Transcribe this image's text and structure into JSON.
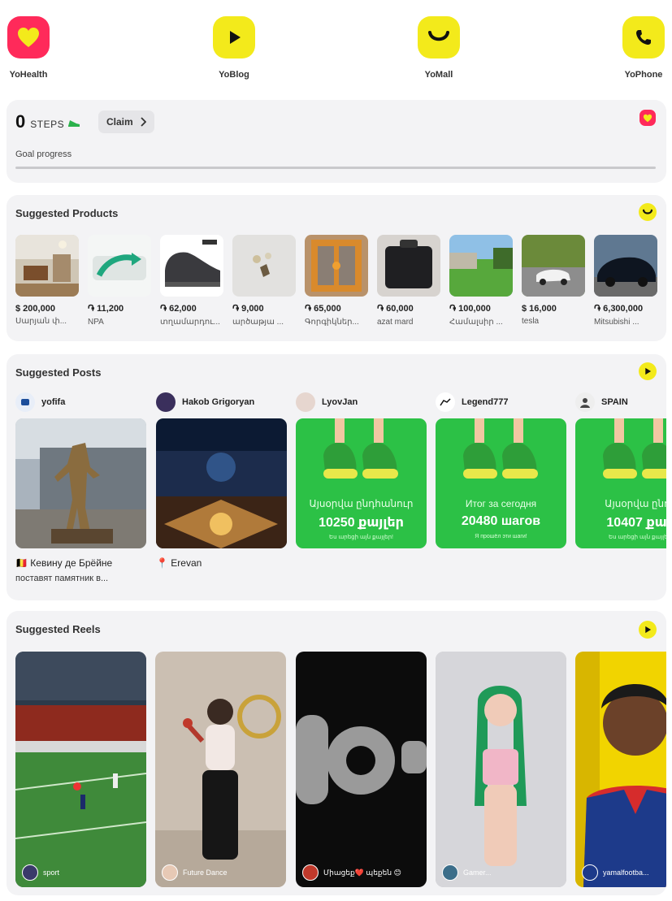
{
  "apps": [
    {
      "label": "YoHealth",
      "icon": "heart-icon",
      "color": "#ff2a5a"
    },
    {
      "label": "YoBlog",
      "icon": "play-icon",
      "color": "#f3ea1b"
    },
    {
      "label": "YoMall",
      "icon": "smile-icon",
      "color": "#f3ea1b"
    },
    {
      "label": "YoPhone",
      "icon": "phone-icon",
      "color": "#f3ea1b"
    }
  ],
  "steps": {
    "count": "0",
    "unit": "STEPS",
    "claim_label": "Claim",
    "goal_label": "Goal progress",
    "goal_progress": 0
  },
  "products": {
    "title": "Suggested Products",
    "items": [
      {
        "price": "$ 200,000",
        "name": "Սարյան փ..."
      },
      {
        "price": "֏ 11,200",
        "name": "NPA"
      },
      {
        "price": "֏ 62,000",
        "name": "տղամարդու..."
      },
      {
        "price": "֏ 9,000",
        "name": "արծաթյա ..."
      },
      {
        "price": "֏ 65,000",
        "name": "Գորգիկներ..."
      },
      {
        "price": "֏ 60,000",
        "name": "azat mard"
      },
      {
        "price": "֏ 100,000",
        "name": "Համալսիր ..."
      },
      {
        "price": "$ 16,000",
        "name": "tesla"
      },
      {
        "price": "֏ 6,300,000",
        "name": "Mitsubishi ..."
      }
    ]
  },
  "posts": {
    "title": "Suggested Posts",
    "items": [
      {
        "author": "yofifa",
        "caption1": "🇧🇪 Кевину де Брёйне",
        "caption2": "поставят памятник в..."
      },
      {
        "author": "Hakob Grigoryan",
        "caption1": "📍 Erevan",
        "caption2": ""
      },
      {
        "author": "LyovJan",
        "caption1": "",
        "caption2": "",
        "overlay": [
          "Այսօրվա ընդհանուր",
          "10250 քայլեր",
          "Ես արեցի այն քայլեր!"
        ]
      },
      {
        "author": "Legend777",
        "caption1": "",
        "caption2": "",
        "overlay": [
          "Итог за сегодня",
          "20480 шагов",
          "Я прошёл эти шаги!"
        ]
      },
      {
        "author": "SPAIN",
        "caption1": "",
        "caption2": "",
        "overlay": [
          "Այսօրվա ընդհ",
          "10407 քայլ",
          "Ես արեցի այն քայլեր!"
        ]
      }
    ]
  },
  "reels": {
    "title": "Suggested Reels",
    "items": [
      {
        "label": "sport"
      },
      {
        "label": "Future Dance"
      },
      {
        "label": "Միացեք❤️ պեքեն 😊"
      },
      {
        "label": "Gamer..."
      },
      {
        "label": "yamalfootba..."
      }
    ]
  }
}
